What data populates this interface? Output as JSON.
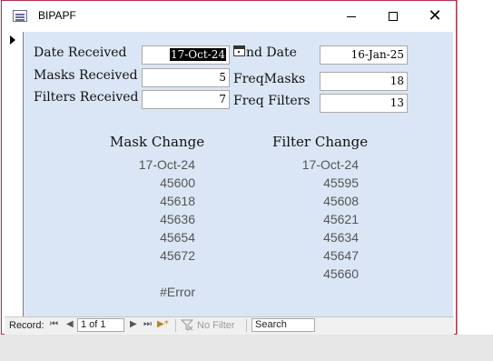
{
  "window": {
    "title": "BIPAPF"
  },
  "form": {
    "date_received_label": "Date Received",
    "date_received_value": "17-Oct-24",
    "masks_received_label": "Masks Received",
    "masks_received_value": "5",
    "filters_received_label": "Filters Received",
    "filters_received_value": "7",
    "end_date_label": "nd Date",
    "end_date_value": "16-Jan-25",
    "freq_masks_label": "FreqMasks",
    "freq_masks_value": "18",
    "freq_filters_label": "Freq Filters",
    "freq_filters_value": "13"
  },
  "mask_change": {
    "heading": "Mask Change",
    "values": [
      "17-Oct-24",
      "45600",
      "45618",
      "45636",
      "45654",
      "45672",
      "",
      "#Error"
    ]
  },
  "filter_change": {
    "heading": "Filter Change",
    "values": [
      "17-Oct-24",
      "45595",
      "45608",
      "45621",
      "45634",
      "45647",
      "45660"
    ]
  },
  "navbar": {
    "record_label": "Record:",
    "record_position": "1 of 1",
    "no_filter_label": "No Filter",
    "search_placeholder": "Search",
    "first_icon": "⏮",
    "prev_icon": "◀",
    "next_icon": "▶",
    "last_icon": "⏭",
    "new_icon": "▶*"
  },
  "colors": {
    "form_background": "#dae6f5",
    "window_border": "#b9304a",
    "selection": "#000000"
  }
}
